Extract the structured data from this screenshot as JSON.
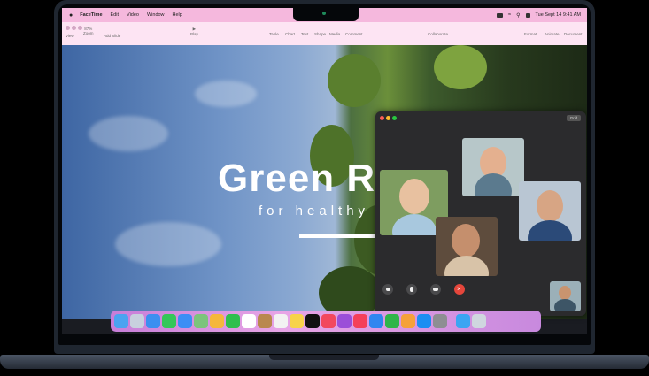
{
  "menubar": {
    "apple": "",
    "app_name": "FaceTime",
    "menus": [
      "Edit",
      "Video",
      "Window",
      "Help"
    ],
    "clock": "Tue Sept 14  9:41 AM"
  },
  "toolbar": {
    "items_left": [
      "View",
      "Zoom",
      "Add Slide"
    ],
    "zoom_value": "87%",
    "play": "Play",
    "items_mid": [
      "Table",
      "Chart",
      "Text",
      "Shape",
      "Media",
      "Comment"
    ],
    "collaborate": "Collaborate",
    "items_right": [
      "Format",
      "Animate",
      "Document"
    ]
  },
  "slide": {
    "title": "Green R",
    "subtitle": "for healthy c"
  },
  "facetime": {
    "grid_button": "Grid"
  },
  "colors": {
    "menubar": "#f5b8dd",
    "toolbar": "#fde4f3",
    "end_call": "#e5463b",
    "dock": "#d89be0"
  },
  "dock_icons": [
    "finder-icon",
    "launchpad-icon",
    "safari-icon",
    "messages-icon",
    "mail-icon",
    "maps-icon",
    "photos-icon",
    "facetime-icon",
    "calendar-icon",
    "contacts-icon",
    "reminders-icon",
    "notes-icon",
    "tv-icon",
    "music-icon",
    "podcasts-icon",
    "news-icon",
    "keynote-icon",
    "numbers-icon",
    "pages-icon",
    "app-store-icon",
    "system-settings-icon",
    "downloads-icon",
    "trash-icon"
  ]
}
